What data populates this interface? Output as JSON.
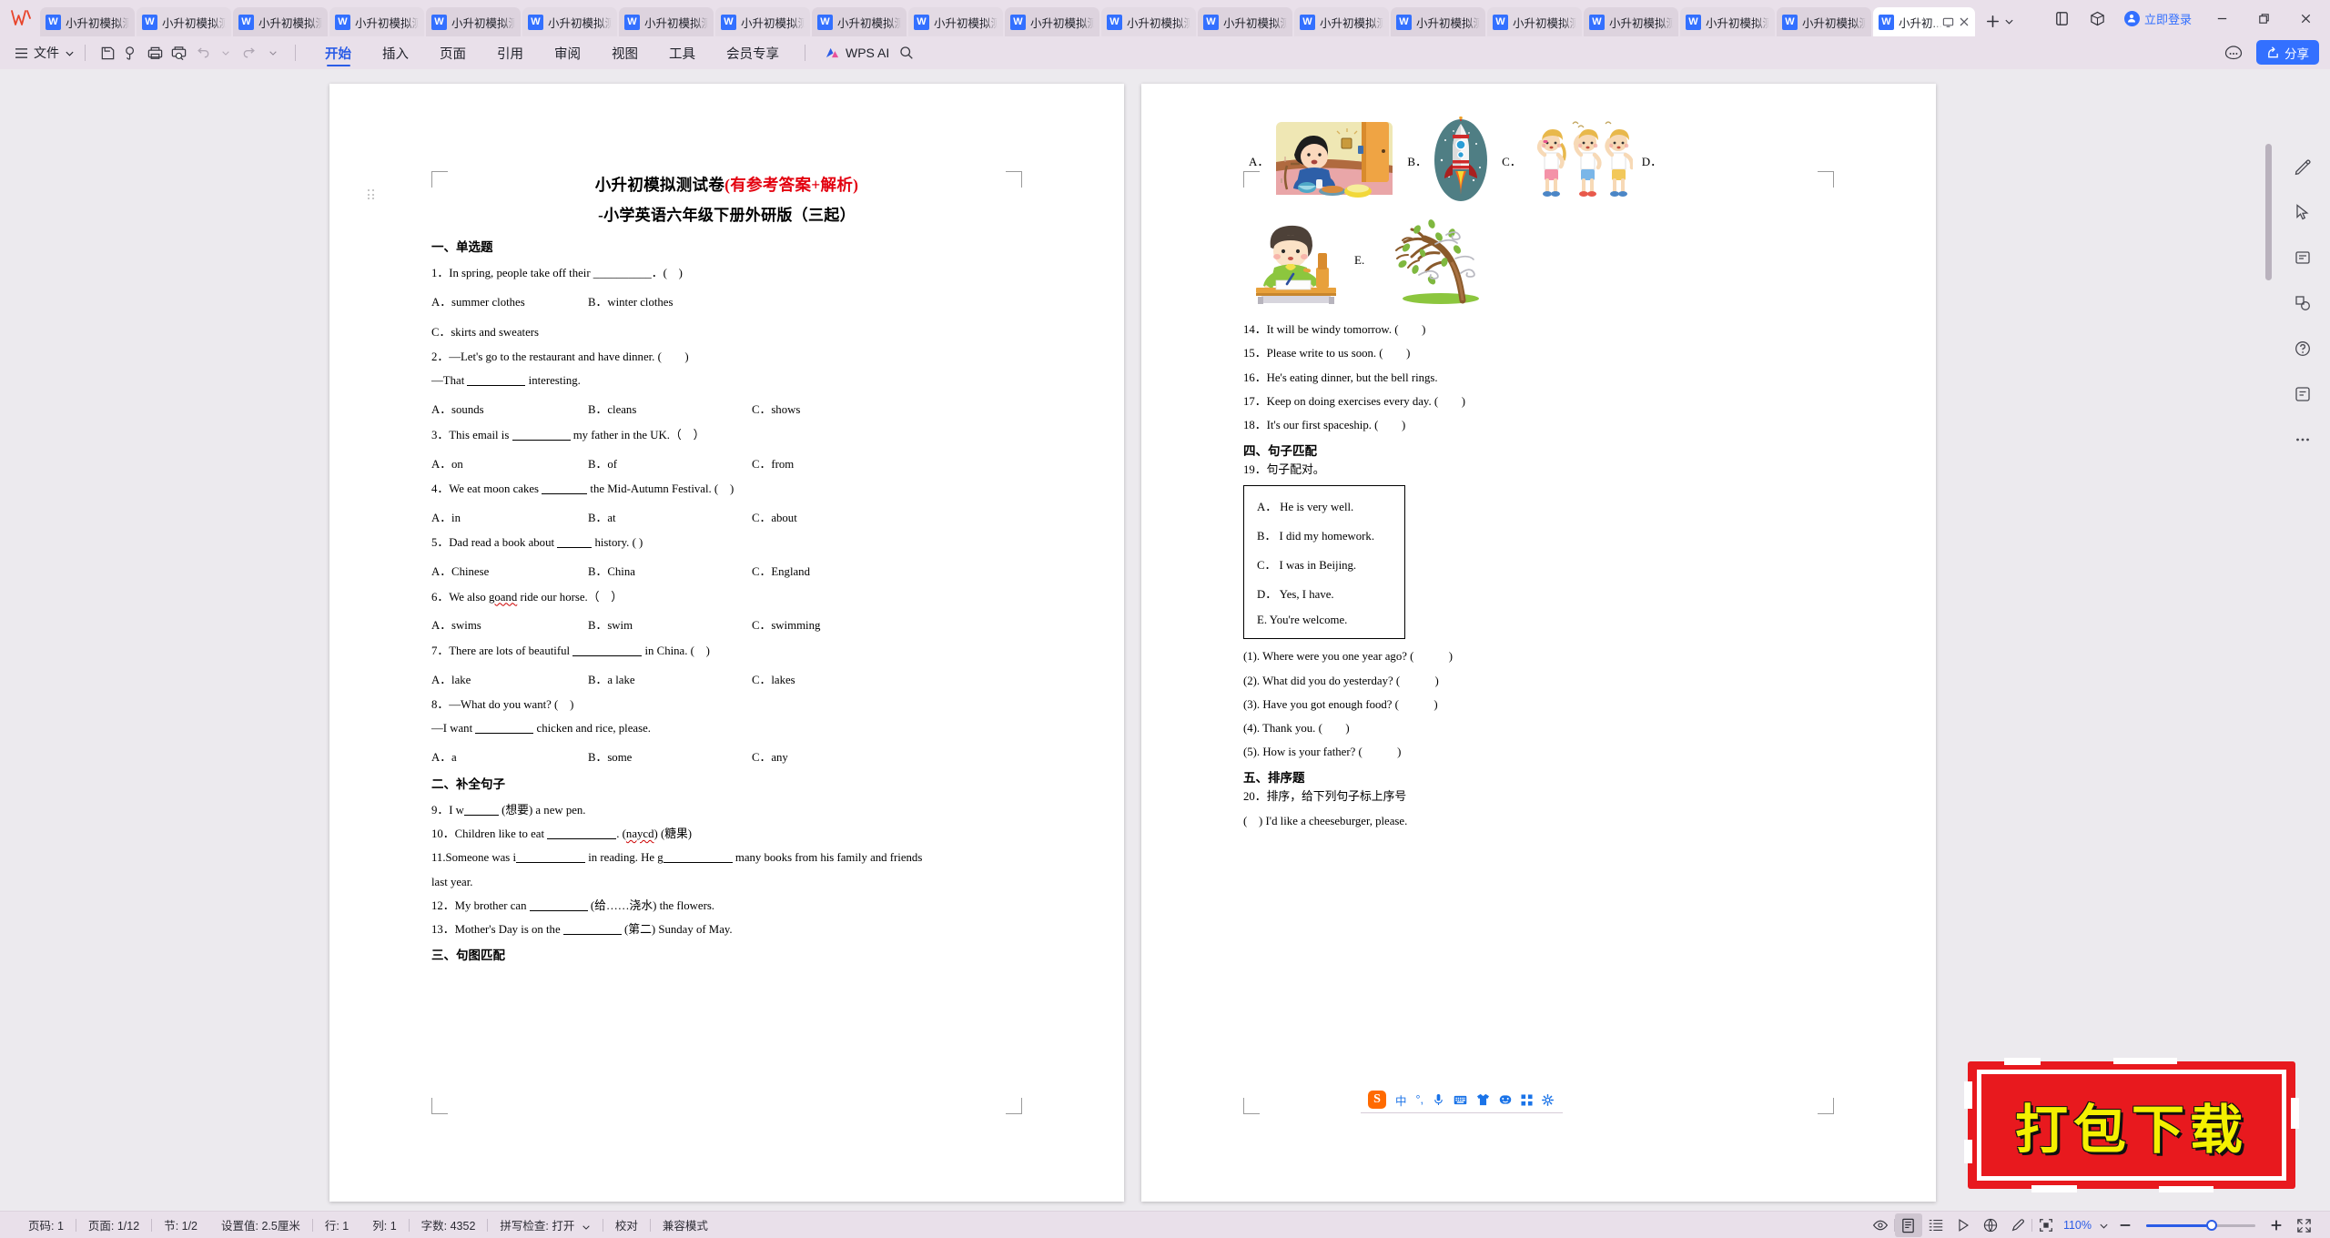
{
  "window": {
    "app_logo": "wps-logo",
    "tabs": [
      {
        "label": "小升初模拟测..."
      },
      {
        "label": "小升初模拟测..."
      },
      {
        "label": "小升初模拟测..."
      },
      {
        "label": "小升初模拟测..."
      },
      {
        "label": "小升初模拟测..."
      },
      {
        "label": "小升初模拟测..."
      },
      {
        "label": "小升初模拟测..."
      },
      {
        "label": "小升初模拟测..."
      },
      {
        "label": "小升初模拟测..."
      },
      {
        "label": "小升初模拟测..."
      },
      {
        "label": "小升初模拟测..."
      },
      {
        "label": "小升初模拟测..."
      },
      {
        "label": "小升初模拟测..."
      },
      {
        "label": "小升初模拟测..."
      },
      {
        "label": "小升初模拟测..."
      },
      {
        "label": "小升初模拟测..."
      },
      {
        "label": "小升初模拟测..."
      },
      {
        "label": "小升初模拟测..."
      },
      {
        "label": "小升初模拟测..."
      }
    ],
    "active_tab": {
      "label": "小升初..."
    },
    "new_tab": "+",
    "login_label": "立即登录",
    "minimize": "−",
    "restore": "❐",
    "close": "✕"
  },
  "ribbon": {
    "file_label": "文件",
    "quick_icons": [
      "save-icon",
      "search-replace-icon",
      "print-icon",
      "print-preview-icon",
      "undo-icon",
      "redo-icon"
    ],
    "tabs": [
      {
        "label": "开始",
        "selected": true
      },
      {
        "label": "插入",
        "selected": false
      },
      {
        "label": "页面",
        "selected": false
      },
      {
        "label": "引用",
        "selected": false
      },
      {
        "label": "审阅",
        "selected": false
      },
      {
        "label": "视图",
        "selected": false
      },
      {
        "label": "工具",
        "selected": false
      },
      {
        "label": "会员专享",
        "selected": false
      }
    ],
    "ai_label": "WPS AI",
    "search": "search-icon",
    "more": "more-icon",
    "share_label": "分享"
  },
  "document": {
    "title_black": "小升初模拟测试卷",
    "title_red": "(有参考答案+解析)",
    "subtitle": "-小学英语六年级下册外研版（三起）",
    "page_left": {
      "sections": [
        {
          "heading": "一、单选题"
        }
      ],
      "q1": "1．In spring, people take off their __________．(　)",
      "q1_a": "A．summer clothes",
      "q1_b": "B．winter clothes",
      "q1_c": "C．skirts and sweaters",
      "q2": "2．—Let's go to the restaurant and have dinner. (　　)",
      "q2_line2_pre": "—That",
      "q2_line2_post": "interesting.",
      "q2_a": "A．sounds",
      "q2_b": "B．cleans",
      "q2_c": "C．shows",
      "q3_pre": "3．This email is",
      "q3_post": "my father in the UK.（　）",
      "q3_a": "A．on",
      "q3_b": "B．of",
      "q3_c": "C．from",
      "q4_pre": "4．We eat moon cakes",
      "q4_post": "the Mid-Autumn Festival. (　)",
      "q4_a": "A．in",
      "q4_b": "B．at",
      "q4_c": "C．about",
      "q5_pre": "5．Dad read a book about",
      "q5_post": "history. ( )",
      "q5_a": "A．Chinese",
      "q5_b": "B．China",
      "q5_c": "C．England",
      "q6_pre": "6．We also",
      "q6_err": "goand",
      "q6_post": "ride our horse.（　）",
      "q6_a": "A．swims",
      "q6_b": "B．swim",
      "q6_c": "C．swimming",
      "q7_pre": "7．There are lots of beautiful",
      "q7_post": "in China. (　)",
      "q7_a": "A．lake",
      "q7_b": "B．a lake",
      "q7_c": "C．lakes",
      "q8": "8．—What do you want? (　)",
      "q8_line2_pre": "—I want",
      "q8_line2_post": "chicken and rice, please.",
      "q8_a": "A．a",
      "q8_b": "B．some",
      "q8_c": "C．any",
      "heading2": "二、补全句子",
      "q9_pre": "9．I w",
      "q9_post": "(想要) a new pen.",
      "q10_pre": "10．Children like to eat",
      "q10_mid": ". (",
      "q10_err": "naycd",
      "q10_post": ") (糖果)",
      "q11_pre": "11.Someone was i",
      "q11_mid": "in reading. He g",
      "q11_post": "many books from his family and friends",
      "q11_line2": "last year.",
      "q12_pre": "12．My brother can",
      "q12_post": "(给……浇水) the flowers.",
      "q13_pre": "13．Mother's Day is on the",
      "q13_post": "(第二) Sunday of May.",
      "heading3": "三、句图匹配"
    },
    "page_right": {
      "pic_labels": [
        "A．",
        "B．",
        "C．",
        "D．",
        "E."
      ],
      "pic_names": [
        "boy-eating-dinner-picture",
        "rocket-spaceship-picture",
        "children-exercising-picture",
        "boy-writing-at-desk-picture",
        "windy-tree-picture"
      ],
      "q14": "14．It will be windy tomorrow. (　　)",
      "q15": "15．Please write to us soon. (　　)",
      "q16": "16．He's eating dinner, but the bell rings.",
      "q17": "17．Keep on doing exercises every day. (　　)",
      "q18": "18．It's our first spaceship. (　　)",
      "heading4": "四、句子匹配",
      "q19": "19．句子配对。",
      "match_options": [
        "A． He is very well.",
        "B． I did my homework.",
        "C．  I was in Beijing.",
        "D． Yes, I have.",
        "E. You're welcome."
      ],
      "match_questions": [
        "(1). Where were you one year ago? (　　　)",
        "(2). What did you do yesterday? (　　　)",
        "(3). Have you got enough food? (　　　)",
        "(4). Thank you. (　　)",
        "(5). How is your father? (　　　)"
      ],
      "heading5": "五、排序题",
      "q20": "20．排序，给下列句子标上序号",
      "q20_item1": "(　) I'd like a cheeseburger, please."
    }
  },
  "ime": {
    "logo": "sogou-logo",
    "mode": "中",
    "punctuation": "°,",
    "icons": [
      "mic-icon",
      "keyboard-icon",
      "skin-icon",
      "emoji-icon",
      "apps-icon",
      "settings-icon"
    ]
  },
  "watermark": {
    "text": "打包下载",
    "bg_color": "#e8191e",
    "text_color": "#f5f000"
  },
  "statusbar": {
    "left_items": [
      "页码: 1",
      "页面: 1/12",
      "节: 1/2",
      "设置值: 2.5厘米",
      "行: 1",
      "列: 1",
      "字数: 4352",
      "拼写检查: 打开",
      "校对",
      "兼容模式"
    ],
    "view_icons": [
      "eye-icon",
      "page-layout-icon",
      "outline-icon",
      "presentation-icon",
      "web-layout-icon",
      "highlighter-icon",
      "fullscreen-reading-icon"
    ],
    "zoom": "110%",
    "zoom_out": "−",
    "zoom_in": "+",
    "expand": "fullscreen-icon"
  },
  "rail": {
    "icons": [
      "edit-pen-icon",
      "pointer-icon",
      "ocr-icon",
      "shape-icon",
      "help-icon",
      "feedback-icon",
      "more-dots-icon"
    ]
  }
}
